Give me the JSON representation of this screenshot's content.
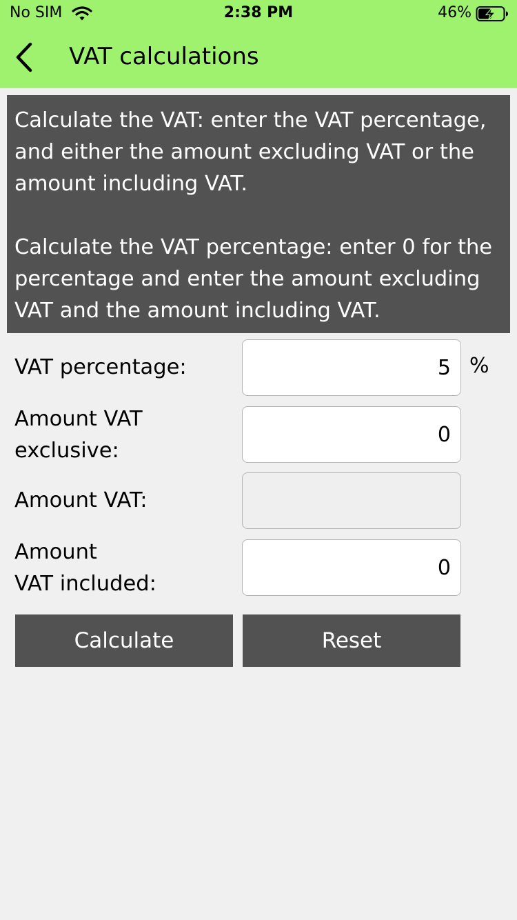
{
  "status_bar": {
    "carrier": "No SIM",
    "time": "2:38 PM",
    "battery": "46%"
  },
  "nav": {
    "back_icon": "chevron-left-icon",
    "title": "VAT calculations"
  },
  "info": {
    "paragraph1": "Calculate the VAT: enter the VAT percentage, and either the amount excluding VAT or the amount including VAT.",
    "paragraph2": "Calculate the VAT percentage: enter 0 for the percentage and enter the amount excluding VAT and the amount including VAT."
  },
  "form": {
    "vat_percentage": {
      "label": "VAT percentage:",
      "value": "5",
      "unit": "%"
    },
    "amount_exclusive": {
      "label_line1": "Amount VAT",
      "label_line2": "exclusive:",
      "value": "0"
    },
    "amount_vat": {
      "label": "Amount VAT:",
      "value": ""
    },
    "amount_included": {
      "label_line1": "Amount",
      "label_line2": "VAT included:",
      "value": "0"
    }
  },
  "buttons": {
    "calculate": "Calculate",
    "reset": "Reset"
  },
  "colors": {
    "header_bg": "#9ef26e",
    "panel_bg": "#525252",
    "page_bg": "#f0f0f0"
  }
}
